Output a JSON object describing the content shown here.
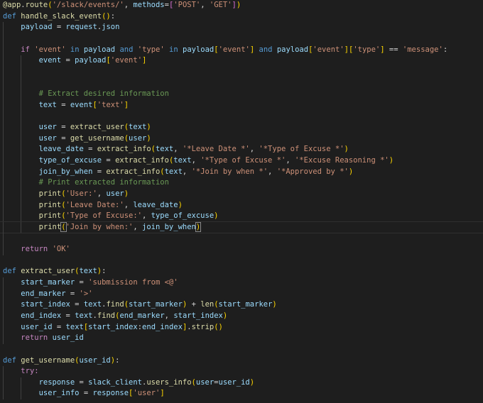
{
  "editor": {
    "language": "python",
    "current_line": 21,
    "lines": [
      "@app.route('/slack/events/', methods=['POST', 'GET'])",
      "def handle_slack_event():",
      "    payload = request.json",
      "",
      "    if 'event' in payload and 'type' in payload['event'] and payload['event']['type'] == 'message':",
      "        event = payload['event']",
      "",
      "",
      "        # Extract desired information",
      "        text = event['text']",
      "",
      "        user = extract_user(text)",
      "        user = get_username(user)",
      "        leave_date = extract_info(text, '*Leave Date *', '*Type of Excuse *')",
      "        type_of_excuse = extract_info(text, '*Type of Excuse *', '*Excuse Reasoning *')",
      "        join_by_when = extract_info(text, '*Join by when *', '*Approved by *')",
      "        # Print extracted information",
      "        print('User:', user)",
      "        print('Leave Date:', leave_date)",
      "        print('Type of Excuse:', type_of_excuse)",
      "        print('Join by when:', join_by_when)",
      "",
      "    return 'OK'",
      "",
      "def extract_user(text):",
      "    start_marker = 'submission from <@'",
      "    end_marker = '>'",
      "    start_index = text.find(start_marker) + len(start_marker)",
      "    end_index = text.find(end_marker, start_index)",
      "    user_id = text[start_index:end_index].strip()",
      "    return user_id",
      "",
      "def get_username(user_id):",
      "    try:",
      "        response = slack_client.users_info(user=user_id)",
      "        user_info = response['user']"
    ]
  },
  "colors": {
    "background": "#1e1e1e",
    "keyword": "#569cd6",
    "control": "#c586c0",
    "function": "#dcdcaa",
    "variable": "#9cdcfe",
    "string": "#ce9178",
    "comment": "#6a9955"
  }
}
